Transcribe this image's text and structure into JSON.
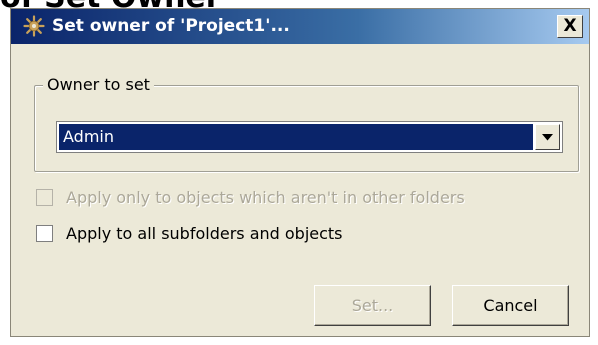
{
  "background_heading": "of Set Owner",
  "window": {
    "title": "Set owner of 'Project1'...",
    "close_label": "X",
    "close_icon": "close-icon",
    "app_icon": "gear-icon"
  },
  "owner_group": {
    "label": "Owner to set",
    "selected_value": "Admin",
    "dropdown_icon": "chevron-down-icon"
  },
  "options": [
    {
      "label": "Apply only to objects which aren't in other folders",
      "checked": false,
      "enabled": false
    },
    {
      "label": "Apply to all subfolders and objects",
      "checked": false,
      "enabled": true
    }
  ],
  "buttons": {
    "set_label": "Set...",
    "set_enabled": false,
    "cancel_label": "Cancel"
  },
  "colors": {
    "titlebar_start": "#0a246a",
    "titlebar_end": "#a6caf0",
    "dialog_bg": "#ece9d8",
    "selection": "#0a246a"
  }
}
